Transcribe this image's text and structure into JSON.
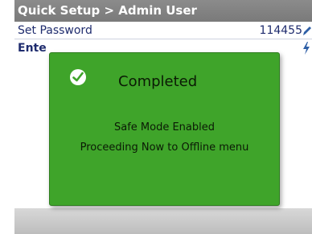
{
  "header": {
    "breadcrumb": "Quick Setup > Admin User"
  },
  "rows": [
    {
      "label": "Set Password",
      "value": "114455",
      "icon": "pencil-edit-icon"
    },
    {
      "label": "Ente",
      "icon": "lightning-bolt-icon"
    }
  ],
  "dialog": {
    "status_icon": "checkmark-icon",
    "title": "Completed",
    "message_line1": "Safe Mode Enabled",
    "message_line2": "Proceeding Now to Offline menu"
  },
  "colors": {
    "header_bg": "#8b8b8b",
    "dialog_bg": "#3fa42a",
    "row_text": "#1f2c6e",
    "accent_icon": "#2e5fa6"
  }
}
